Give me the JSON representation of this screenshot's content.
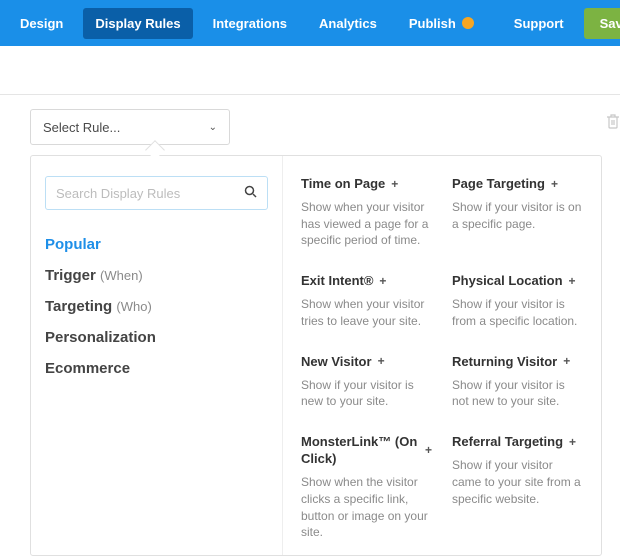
{
  "nav": {
    "items": [
      {
        "label": "Design"
      },
      {
        "label": "Display Rules",
        "active": true
      },
      {
        "label": "Integrations"
      },
      {
        "label": "Analytics"
      },
      {
        "label": "Publish",
        "badge": true
      },
      {
        "label": "Support"
      }
    ],
    "save_label": "Save"
  },
  "rule_select": {
    "placeholder": "Select Rule..."
  },
  "search": {
    "placeholder": "Search Display Rules"
  },
  "categories": [
    {
      "label": "Popular",
      "sub": "",
      "active": true
    },
    {
      "label": "Trigger",
      "sub": "(When)"
    },
    {
      "label": "Targeting",
      "sub": "(Who)"
    },
    {
      "label": "Personalization",
      "sub": ""
    },
    {
      "label": "Ecommerce",
      "sub": ""
    }
  ],
  "rules": [
    {
      "title": "Time on Page",
      "desc": "Show when your visitor has viewed a page for a specific period of time."
    },
    {
      "title": "Page Targeting",
      "desc": "Show if your visitor is on a specific page."
    },
    {
      "title": "Exit Intent®",
      "desc": "Show when your visitor tries to leave your site."
    },
    {
      "title": "Physical Location",
      "desc": "Show if your visitor is from a specific location."
    },
    {
      "title": "New Visitor",
      "desc": "Show if your visitor is new to your site."
    },
    {
      "title": "Returning Visitor",
      "desc": "Show if your visitor is not new to your site."
    },
    {
      "title": "MonsterLink™ (On Click)",
      "desc": "Show when the visitor clicks a specific link, button or image on your site."
    },
    {
      "title": "Referral Targeting",
      "desc": "Show if your visitor came to your site from a specific website."
    }
  ]
}
